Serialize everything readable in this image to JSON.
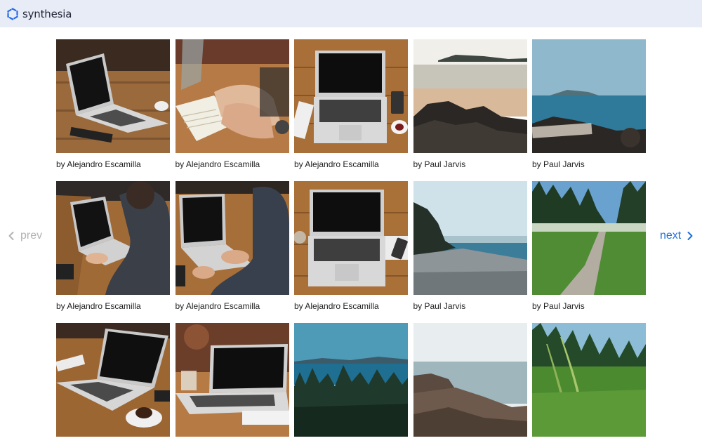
{
  "header": {
    "brand": "synthesia",
    "logo_icon": "synthesia-logo-icon",
    "background": "#e8ecf7"
  },
  "pagination": {
    "prev_label": "prev",
    "next_label": "next",
    "prev_color": "#b3b3b3",
    "next_color": "#1f6fd6"
  },
  "gallery": [
    {
      "author": "by Alejandro Escamilla",
      "scene": "laptop-on-desk"
    },
    {
      "author": "by Alejandro Escamilla",
      "scene": "hands-writing-notebook"
    },
    {
      "author": "by Alejandro Escamilla",
      "scene": "laptop-top-view"
    },
    {
      "author": "by Paul Jarvis",
      "scene": "rocky-beach"
    },
    {
      "author": "by Paul Jarvis",
      "scene": "sea-with-driftwood"
    },
    {
      "author": "by Alejandro Escamilla",
      "scene": "person-typing-laptop"
    },
    {
      "author": "by Alejandro Escamilla",
      "scene": "person-typing-laptop-2"
    },
    {
      "author": "by Alejandro Escamilla",
      "scene": "laptop-top-view-2"
    },
    {
      "author": "by Paul Jarvis",
      "scene": "pebble-shore"
    },
    {
      "author": "by Paul Jarvis",
      "scene": "forest-path"
    },
    {
      "author": "",
      "scene": "laptop-with-coffee"
    },
    {
      "author": "",
      "scene": "laptop-on-wood-table"
    },
    {
      "author": "",
      "scene": "forest-and-lake"
    },
    {
      "author": "",
      "scene": "rocky-coast"
    },
    {
      "author": "",
      "scene": "tall-grass"
    }
  ]
}
